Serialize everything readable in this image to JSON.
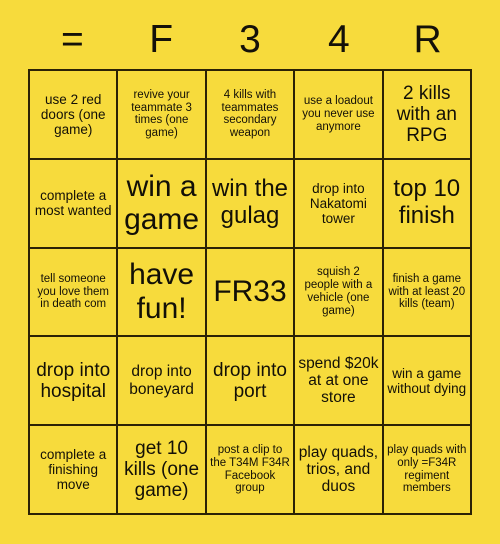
{
  "card": {
    "header_letters": [
      "=",
      "F",
      "3",
      "4",
      "R"
    ],
    "columns": 5,
    "rows": 5,
    "background_color": "#f7db3c",
    "border_color": "#2b2205",
    "text_color": "#131007",
    "squares": [
      {
        "text": "use 2 red doors (one game)",
        "size": "s"
      },
      {
        "text": "revive your teammate 3 times (one game)",
        "size": "xs"
      },
      {
        "text": "4 kills with teammates secondary weapon",
        "size": "xs"
      },
      {
        "text": "use a loadout you never use anymore",
        "size": "xs"
      },
      {
        "text": "2 kills with an RPG",
        "size": "l"
      },
      {
        "text": "complete a most wanted",
        "size": "s"
      },
      {
        "text": "win a game",
        "size": "xxl"
      },
      {
        "text": "win the gulag",
        "size": "xl"
      },
      {
        "text": "drop into Nakatomi tower",
        "size": "s"
      },
      {
        "text": "top 10 finish",
        "size": "xl"
      },
      {
        "text": "tell someone you love them in death com",
        "size": "xs"
      },
      {
        "text": "have fun!",
        "size": "xxl"
      },
      {
        "text": "FR33",
        "size": "xxl"
      },
      {
        "text": "squish 2 people with a vehicle (one game)",
        "size": "xs"
      },
      {
        "text": "finish a game with at least 20 kills (team)",
        "size": "xs"
      },
      {
        "text": "drop into hospital",
        "size": "l"
      },
      {
        "text": "drop into boneyard",
        "size": "m"
      },
      {
        "text": "drop into port",
        "size": "l"
      },
      {
        "text": "spend $20k at at one store",
        "size": "m"
      },
      {
        "text": "win a game without dying",
        "size": "s"
      },
      {
        "text": "complete a finishing move",
        "size": "s"
      },
      {
        "text": "get 10 kills (one game)",
        "size": "l"
      },
      {
        "text": "post a clip to the T34M F34R Facebook group",
        "size": "xs"
      },
      {
        "text": "play quads, trios, and duos",
        "size": "m"
      },
      {
        "text": "play quads with only =F34R regiment members",
        "size": "xs"
      }
    ]
  }
}
